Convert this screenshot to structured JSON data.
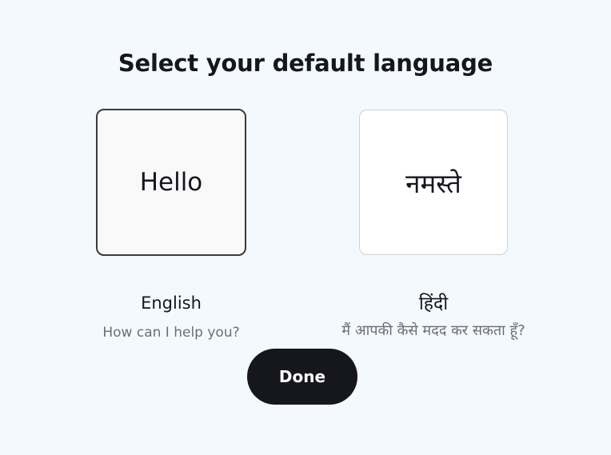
{
  "page": {
    "title": "Select your default language"
  },
  "languages": [
    {
      "id": "en",
      "greeting": "Hello",
      "name": "English",
      "subtitle": "How can I help you?",
      "selected": true
    },
    {
      "id": "hi",
      "greeting": "नमस्ते",
      "name": "हिंदी",
      "subtitle": "मैं आपकी कैसे मदद कर सकता हूँ?",
      "selected": false
    }
  ],
  "actions": {
    "done_label": "Done"
  },
  "colors": {
    "background": "#f4f9fd",
    "primary_button": "#16161d",
    "selected_border": "#3a3a40",
    "unselected_border": "#cfcfd4",
    "secondary_text": "#6e6e75"
  }
}
